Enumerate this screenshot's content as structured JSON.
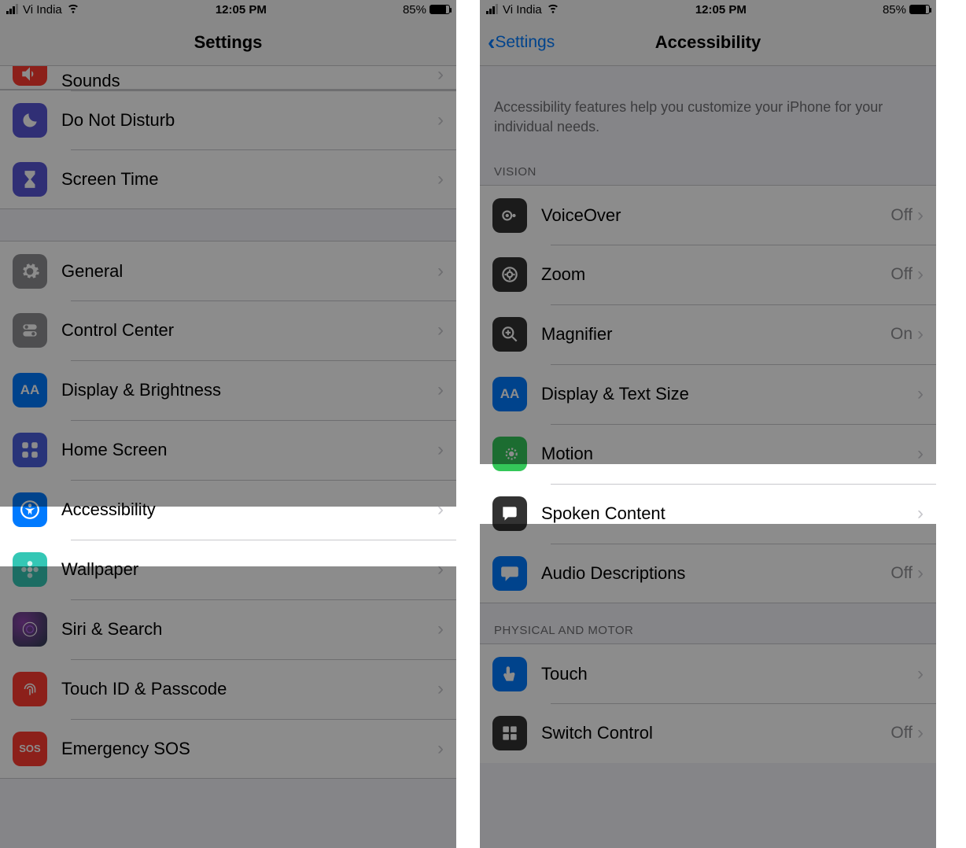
{
  "status": {
    "carrier": "Vi India",
    "time": "12:05 PM",
    "battery": "85%"
  },
  "left": {
    "title": "Settings",
    "rows": {
      "sounds": "Sounds",
      "dnd": "Do Not Disturb",
      "screentime": "Screen Time",
      "general": "General",
      "control": "Control Center",
      "display": "Display & Brightness",
      "home": "Home Screen",
      "accessibility": "Accessibility",
      "wallpaper": "Wallpaper",
      "siri": "Siri & Search",
      "touchid": "Touch ID & Passcode",
      "sos": "Emergency SOS"
    }
  },
  "right": {
    "back": "Settings",
    "title": "Accessibility",
    "desc": "Accessibility features help you customize your iPhone for your individual needs.",
    "sections": {
      "vision": "VISION",
      "physical": "PHYSICAL AND MOTOR"
    },
    "rows": {
      "voiceover": {
        "label": "VoiceOver",
        "value": "Off"
      },
      "zoom": {
        "label": "Zoom",
        "value": "Off"
      },
      "magnifier": {
        "label": "Magnifier",
        "value": "On"
      },
      "displaytext": {
        "label": "Display & Text Size",
        "value": ""
      },
      "motion": {
        "label": "Motion",
        "value": ""
      },
      "spoken": {
        "label": "Spoken Content",
        "value": ""
      },
      "audiodesc": {
        "label": "Audio Descriptions",
        "value": "Off"
      },
      "touch": {
        "label": "Touch",
        "value": ""
      },
      "switch": {
        "label": "Switch Control",
        "value": "Off"
      }
    }
  }
}
